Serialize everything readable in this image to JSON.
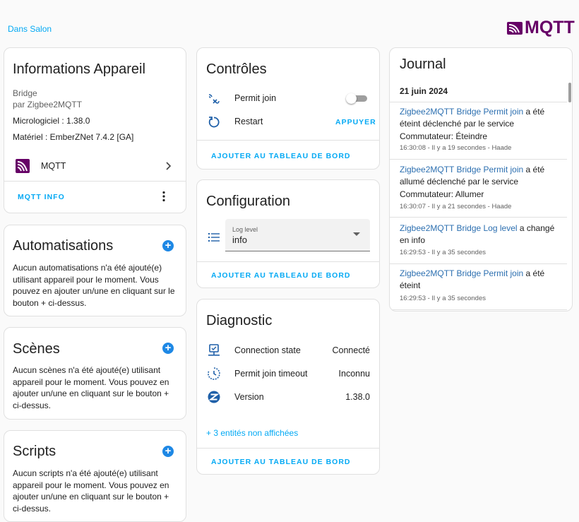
{
  "header": {
    "area_link": "Dans Salon",
    "brand": "MQTT",
    "brand_color": "#660066"
  },
  "info_card": {
    "title": "Informations Appareil",
    "model": "Bridge",
    "manufacturer": "par Zigbee2MQTT",
    "firmware": "Micrologiciel : 1.38.0",
    "hardware": "Matériel : EmberZNet 7.4.2 [GA]",
    "integration_label": "MQTT",
    "integration_icon": "mqtt-icon",
    "action_label": "MQTT INFO",
    "menu_icon": "more-vert-icon"
  },
  "automations_card": {
    "title": "Automatisations",
    "text": "Aucun automatisations n'a été ajouté(e) utilisant appareil pour le moment. Vous pouvez en ajouter un/une en cliquant sur le bouton + ci-dessus."
  },
  "scenes_card": {
    "title": "Scènes",
    "text": "Aucun scènes n'a été ajouté(e) utilisant appareil pour le moment. Vous pouvez en ajouter un/une en cliquant sur le bouton + ci-dessus."
  },
  "scripts_card": {
    "title": "Scripts",
    "text": "Aucun scripts n'a été ajouté(e) utilisant appareil pour le moment. Vous pouvez en ajouter un/une en cliquant sur le bouton + ci-dessus."
  },
  "add_button_symbol": "+",
  "controls_card": {
    "title": "Contrôles",
    "permit_join_label": "Permit join",
    "permit_join_on": false,
    "permit_join_icon": "wifi-pair-icon",
    "restart_label": "Restart",
    "restart_icon": "restart-icon",
    "restart_action": "APPUYER",
    "add_to_dashboard": "AJOUTER AU TABLEAU DE BORD"
  },
  "config_card": {
    "title": "Configuration",
    "log_level_label": "Log level",
    "log_level_value": "info",
    "list_icon": "list-icon",
    "add_to_dashboard": "AJOUTER AU TABLEAU DE BORD"
  },
  "diagnostic_card": {
    "title": "Diagnostic",
    "rows": [
      {
        "icon": "connection-icon",
        "label": "Connection state",
        "value": "Connecté"
      },
      {
        "icon": "timer-icon",
        "label": "Permit join timeout",
        "value": "Inconnu"
      },
      {
        "icon": "zigbee-icon",
        "label": "Version",
        "value": "1.38.0"
      }
    ],
    "hidden_entities": "+ 3 entités non affichées",
    "add_to_dashboard": "AJOUTER AU TABLEAU DE BORD"
  },
  "journal_card": {
    "title": "Journal",
    "date": "21 juin 2024",
    "entries": [
      {
        "entity": "Zigbee2MQTT Bridge Permit join",
        "message": " a été éteint déclenché par le service Commutateur: Éteindre",
        "meta": "16:30:08 - Il y a 19 secondes - Haade"
      },
      {
        "entity": "Zigbee2MQTT Bridge Permit join",
        "message": " a été allumé déclenché par le service Commutateur: Allumer",
        "meta": "16:30:07 - Il y a 21 secondes - Haade"
      },
      {
        "entity": "Zigbee2MQTT Bridge Log level",
        "message": " a changé en info",
        "meta": "16:29:53 - Il y a 35 secondes"
      },
      {
        "entity": "Zigbee2MQTT Bridge Permit join",
        "message": " a été éteint",
        "meta": "16:29:53 - Il y a 35 secondes"
      }
    ]
  },
  "colors": {
    "accent": "#03a9f4",
    "link_entity": "#2c6fb0",
    "add_button": "#1e88e5",
    "icon": "#1e5fa8"
  }
}
